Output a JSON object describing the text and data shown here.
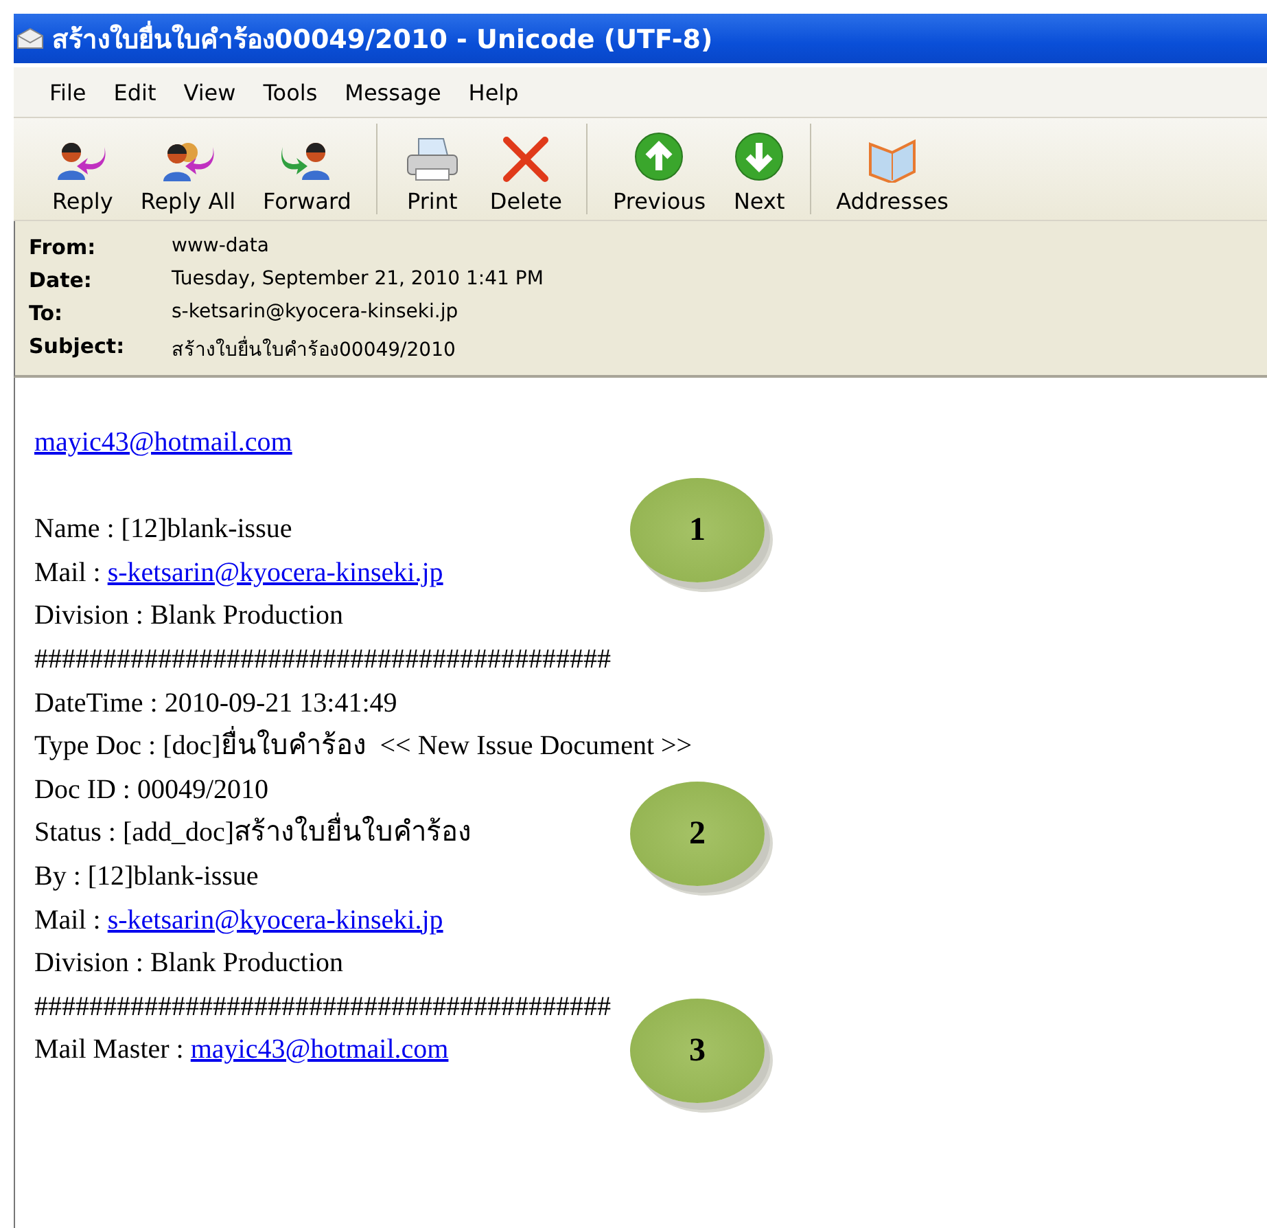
{
  "window": {
    "title": "สร้างใบยื่นใบคำร้อง00049/2010 - Unicode (UTF-8)"
  },
  "menu": [
    "File",
    "Edit",
    "View",
    "Tools",
    "Message",
    "Help"
  ],
  "toolbar": [
    {
      "label": "Reply",
      "kind": "reply"
    },
    {
      "label": "Reply All",
      "kind": "replyall"
    },
    {
      "label": "Forward",
      "kind": "forward"
    },
    {
      "label": "Print",
      "kind": "print",
      "group_start": true
    },
    {
      "label": "Delete",
      "kind": "delete"
    },
    {
      "label": "Previous",
      "kind": "previous",
      "group_start": true
    },
    {
      "label": "Next",
      "kind": "next"
    },
    {
      "label": "Addresses",
      "kind": "addresses",
      "group_start": true
    }
  ],
  "header": [
    {
      "label": "From:",
      "value": "www-data"
    },
    {
      "label": "Date:",
      "value": "Tuesday, September 21, 2010 1:41 PM"
    },
    {
      "label": "To:",
      "value": "s-ketsarin@kyocera-kinseki.jp"
    },
    {
      "label": "Subject:",
      "value": "สร้างใบยื่นใบคำร้อง00049/2010"
    }
  ],
  "body": [
    {
      "kind": "link",
      "link": "mayic43@hotmail.com"
    },
    {
      "kind": "blank"
    },
    {
      "kind": "text",
      "text": "Name : [12]blank-issue",
      "callout": "1"
    },
    {
      "kind": "text",
      "text": "Mail : ",
      "link": "s-ketsarin@kyocera-kinseki.jp"
    },
    {
      "kind": "text",
      "text": "Division : Blank Production"
    },
    {
      "kind": "text",
      "text": "##########################################"
    },
    {
      "kind": "text",
      "text": "DateTime : 2010-09-21 13:41:49"
    },
    {
      "kind": "text",
      "text": "Type Doc : [doc]ยื่นใบคำร้อง  << New Issue Document >>"
    },
    {
      "kind": "text",
      "text": "Doc ID : 00049/2010"
    },
    {
      "kind": "text",
      "text": "Status : [add_doc]สร้างใบยื่นใบคำร้อง",
      "callout": "2"
    },
    {
      "kind": "text",
      "text": "By : [12]blank-issue"
    },
    {
      "kind": "text",
      "text": "Mail : ",
      "link": "s-ketsarin@kyocera-kinseki.jp"
    },
    {
      "kind": "text",
      "text": "Division : Blank Production"
    },
    {
      "kind": "text",
      "text": "##########################################"
    },
    {
      "kind": "text",
      "text": "Mail Master : ",
      "link": "mayic43@hotmail.com",
      "callout": "3"
    }
  ]
}
